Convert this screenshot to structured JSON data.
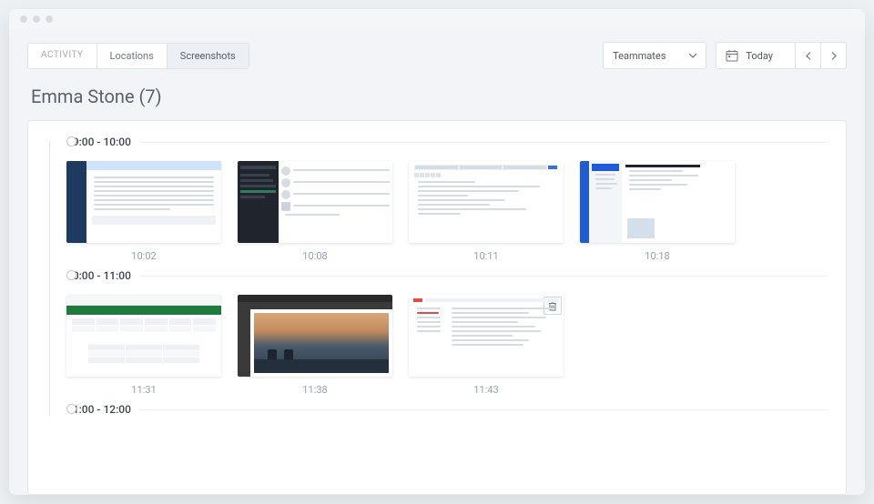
{
  "tabs": {
    "activity": "ACTIVITY",
    "locations": "Locations",
    "screenshots": "Screenshots"
  },
  "filters": {
    "teammates": "Teammates",
    "today": "Today"
  },
  "title": "Emma Stone (7)",
  "sections": [
    {
      "range": "09:00 - 10:00",
      "shots": [
        {
          "time": "10:02"
        },
        {
          "time": "10:08"
        },
        {
          "time": "10:11"
        },
        {
          "time": "10:18"
        }
      ]
    },
    {
      "range": "10:00 - 11:00",
      "shots": [
        {
          "time": "11:31"
        },
        {
          "time": "11:38"
        },
        {
          "time": "11:43",
          "trash": true
        }
      ]
    },
    {
      "range": "11:00 - 12:00",
      "shots": []
    }
  ]
}
